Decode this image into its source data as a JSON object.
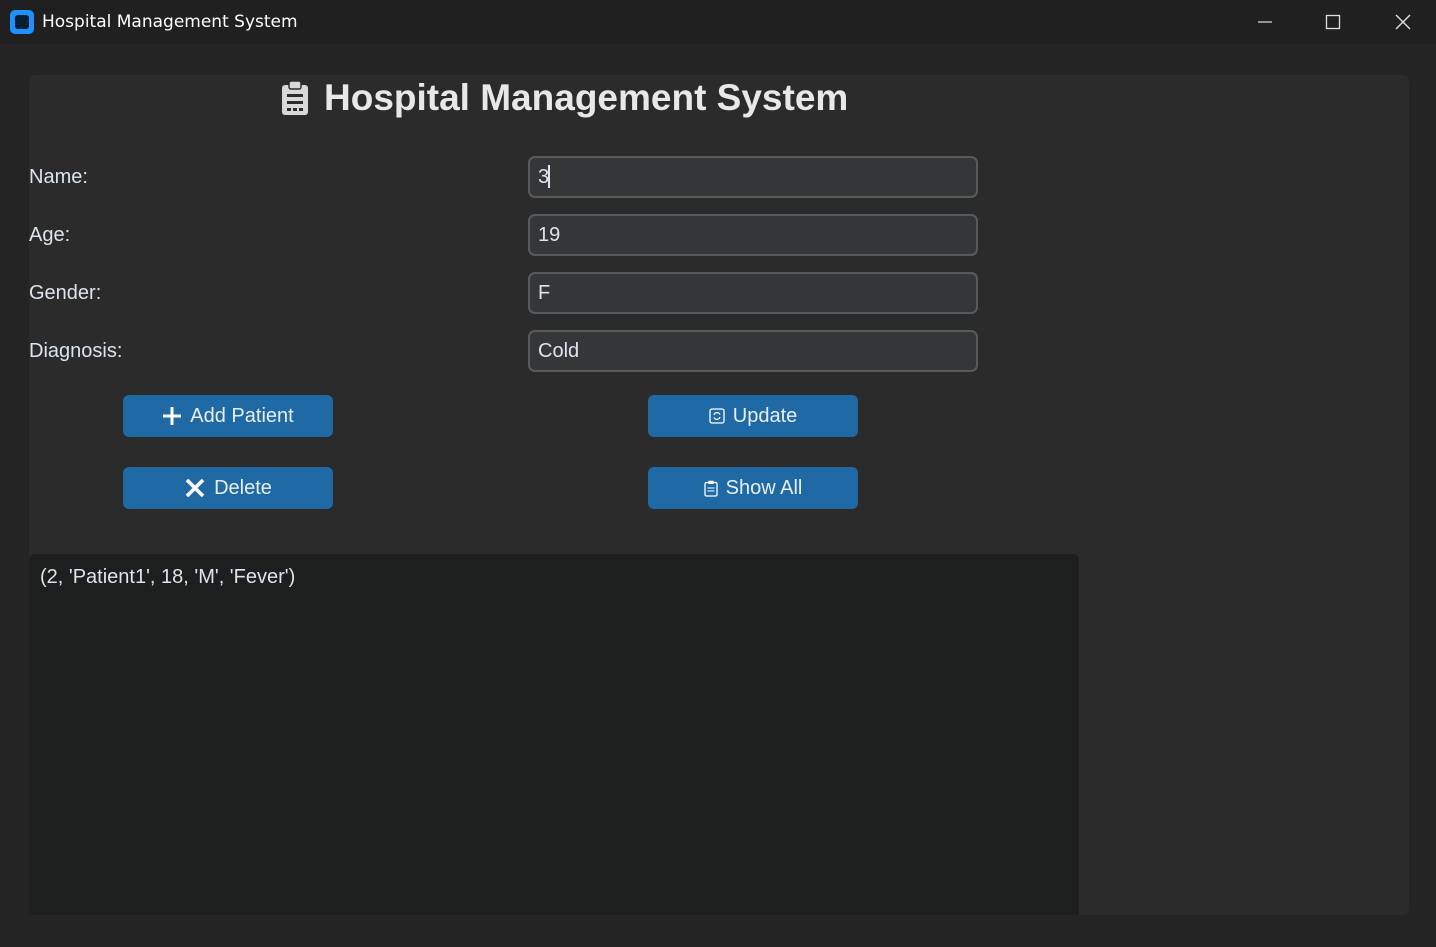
{
  "window": {
    "title": "Hospital Management System",
    "icons": {
      "app": "app-icon",
      "minimize": "minimize-icon",
      "maximize": "maximize-icon",
      "close": "close-icon"
    }
  },
  "header": {
    "title": "Hospital Management System",
    "icon": "clipboard-icon"
  },
  "form": {
    "name_label": "Name:",
    "name_value": "3",
    "age_label": "Age:",
    "age_value": "19",
    "gender_label": "Gender:",
    "gender_value": "F",
    "diagnosis_label": "Diagnosis:",
    "diagnosis_value": "Cold"
  },
  "buttons": {
    "add_label": "Add Patient",
    "add_icon": "plus-icon",
    "update_label": "Update",
    "update_icon": "refresh-icon",
    "delete_label": "Delete",
    "delete_icon": "x-icon",
    "show_all_label": "Show All",
    "show_all_icon": "clipboard-icon"
  },
  "output": {
    "lines": [
      "(2, 'Patient1', 18, 'M', 'Fever')"
    ]
  },
  "colors": {
    "background": "#242424",
    "panel": "#2b2b2b",
    "button": "#1f6aa5",
    "entry": "#343638",
    "entry_border": "#565b5e",
    "output_bg": "#1d1e1e"
  }
}
